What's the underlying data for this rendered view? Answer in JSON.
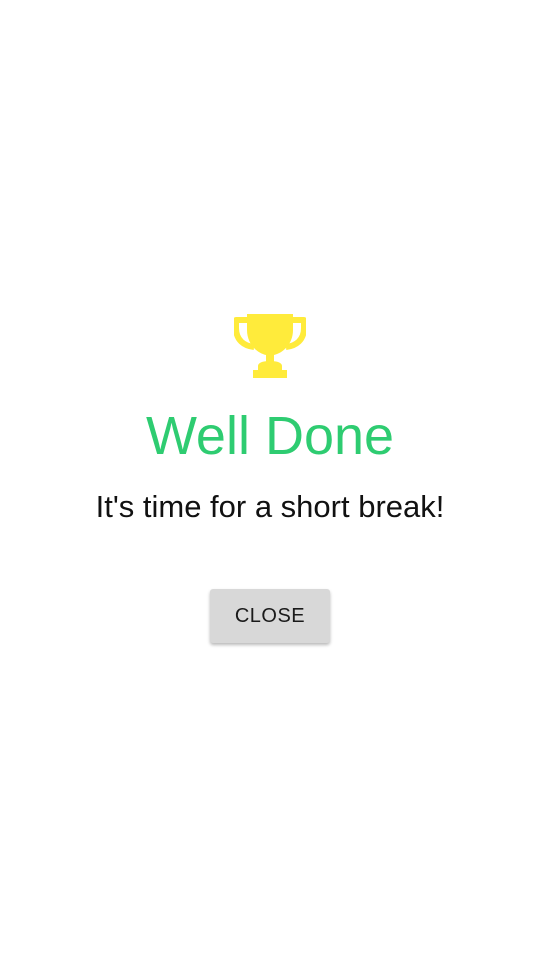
{
  "dialog": {
    "icon": "trophy-icon",
    "title": "Well Done",
    "message": "It's time for a short break!",
    "close_label": "CLOSE"
  },
  "colors": {
    "title": "#2ecc71",
    "trophy": "#ffeb3b",
    "button_bg": "#d8d8d8",
    "background": "#ffffff"
  }
}
